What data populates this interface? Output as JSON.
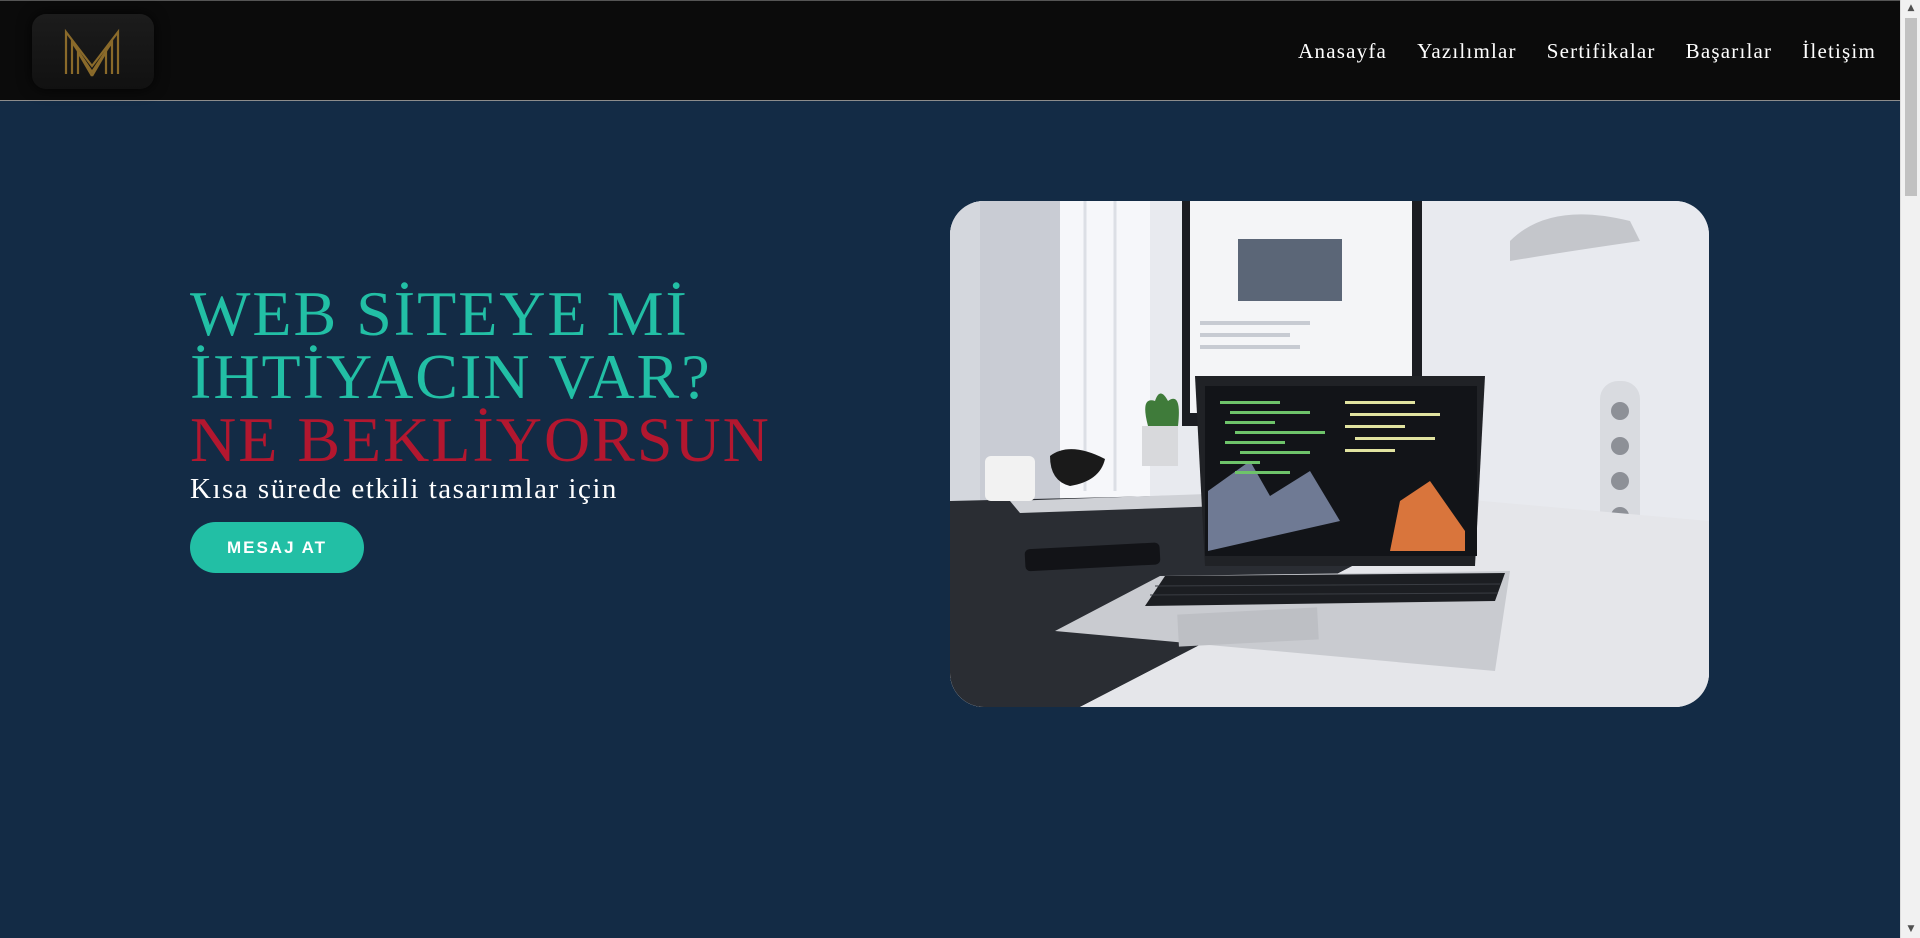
{
  "nav": {
    "logo_icon": "m-monogram-logo",
    "links": [
      "Anasayfa",
      "Yazılımlar",
      "Sertifikalar",
      "Başarılar",
      "İletişim"
    ]
  },
  "hero": {
    "line1": "WEB SİTEYE Mİ",
    "line2": "İHTİYACIN VAR?",
    "line3": "NE BEKLİYORSUN",
    "subline": "Kısa sürede etkili tasarımlar için",
    "cta_label": "MESAJ AT",
    "image_icon": "laptop-desk-photo"
  },
  "colors": {
    "background": "#132b45",
    "navbar": "#0b0b0b",
    "accent_teal": "#22bfa5",
    "accent_red": "#b3172f"
  }
}
